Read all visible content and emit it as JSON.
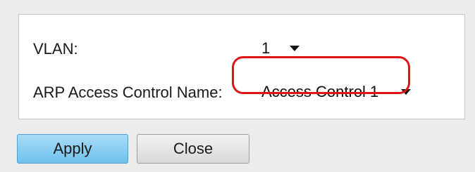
{
  "form": {
    "vlan_label": "VLAN:",
    "vlan_value": "1",
    "arp_label": "ARP Access Control Name:",
    "arp_value": "Access Control 1"
  },
  "buttons": {
    "apply_label": "Apply",
    "close_label": "Close"
  },
  "colors": {
    "highlight": "#e01414",
    "apply_bg": "#8fd0f0",
    "close_bg": "#e4e4e4"
  }
}
